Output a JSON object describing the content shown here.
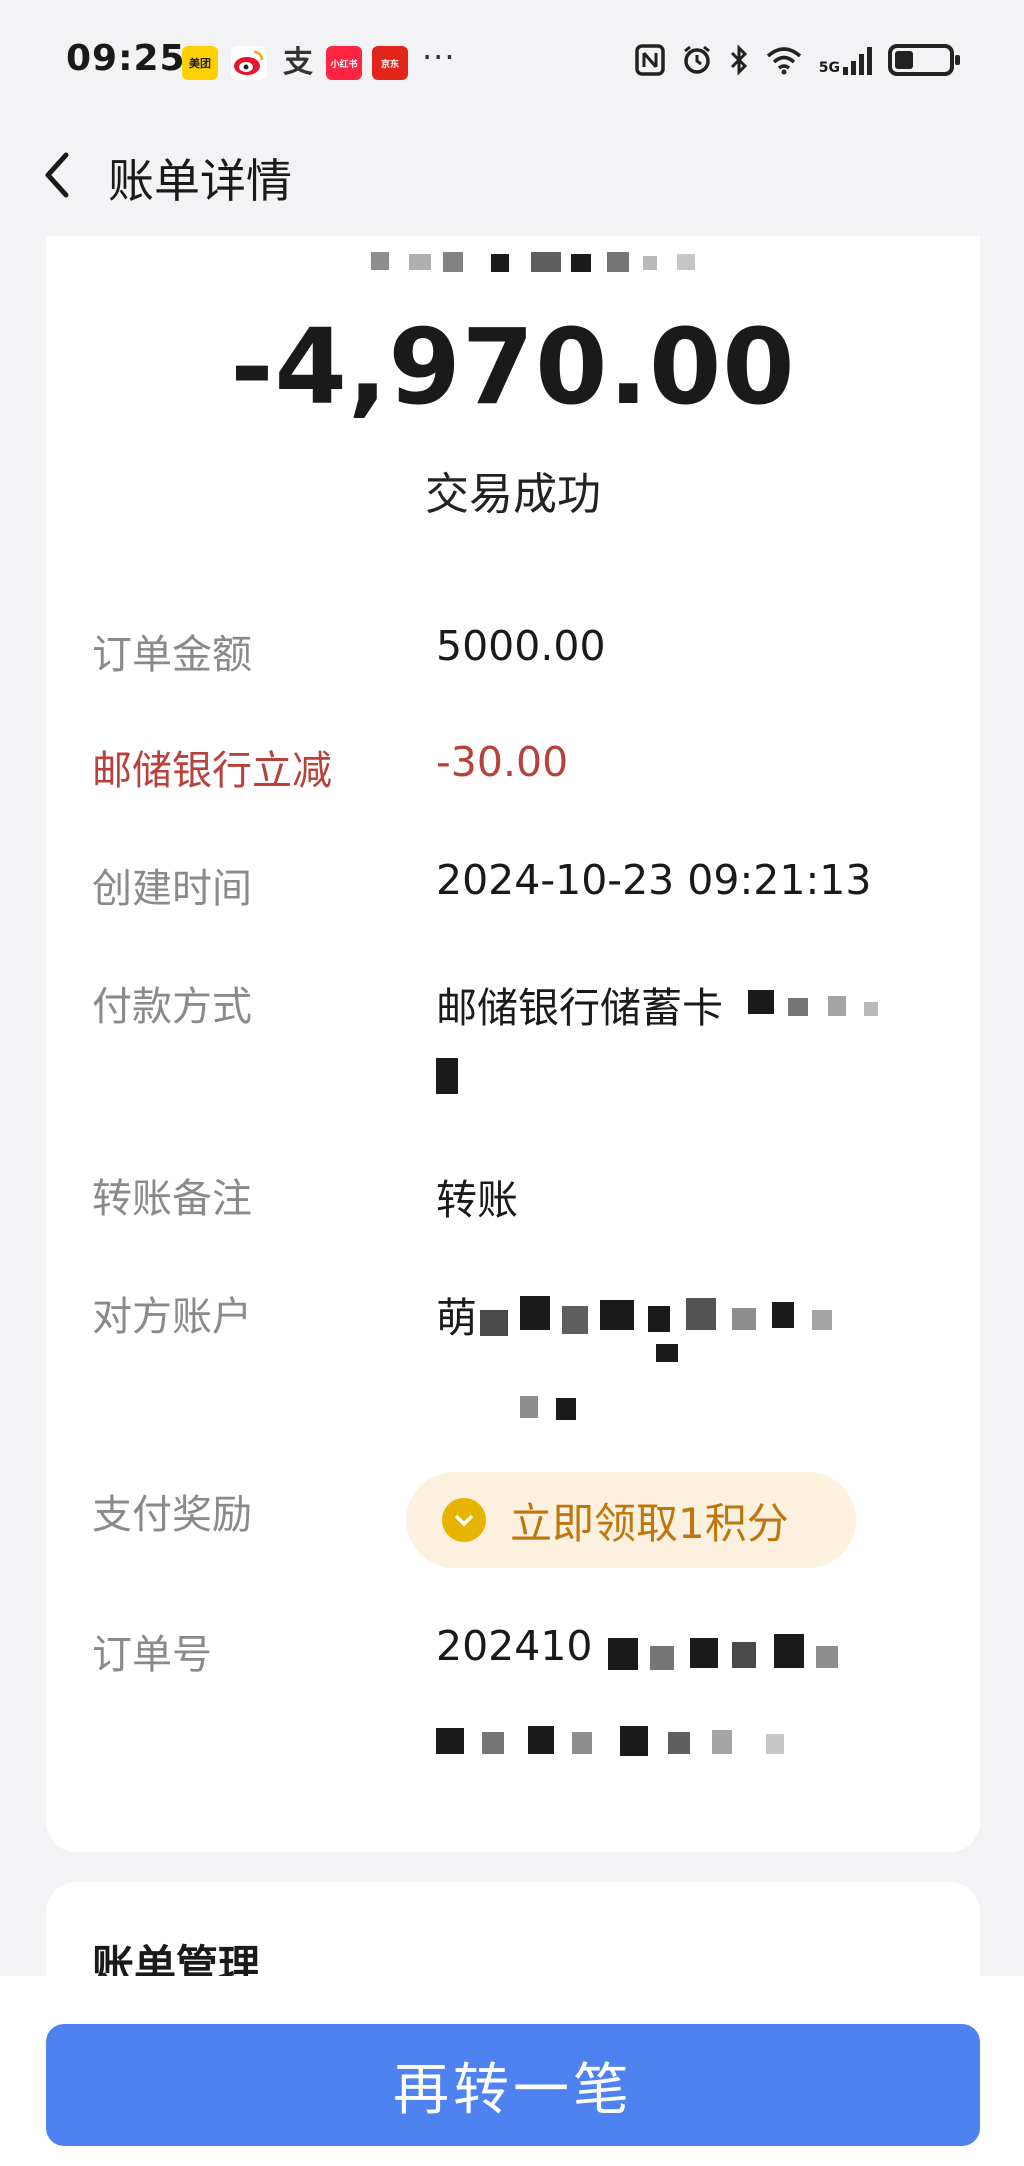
{
  "status_bar": {
    "time": "09:25",
    "apps": [
      "美团",
      "微博",
      "支",
      "小红书",
      "京东"
    ],
    "more": "···",
    "network": "5G"
  },
  "header": {
    "title": "账单详情"
  },
  "transaction": {
    "amount": "-4,970.00",
    "status": "交易成功"
  },
  "details": [
    {
      "label": "订单金额",
      "value": "5000.00"
    },
    {
      "label": "邮储银行立减",
      "value": "-30.00"
    },
    {
      "label": "创建时间",
      "value": "2024-10-23 09:21:13"
    },
    {
      "label": "付款方式",
      "value": "邮储银行储蓄卡"
    },
    {
      "label": "转账备注",
      "value": "转账"
    },
    {
      "label": "对方账户",
      "value": "萌"
    },
    {
      "label": "支付奖励",
      "value": "立即领取1积分"
    },
    {
      "label": "订单号",
      "value": "202410"
    }
  ],
  "bill_management": {
    "title": "账单管理"
  },
  "actions": {
    "repeat_transfer": "再转一笔"
  },
  "colors": {
    "accent_blue": "#4e82f0",
    "discount_red": "#b8413a",
    "reward_gold": "#c0760e",
    "reward_bg": "#fbf1de"
  }
}
